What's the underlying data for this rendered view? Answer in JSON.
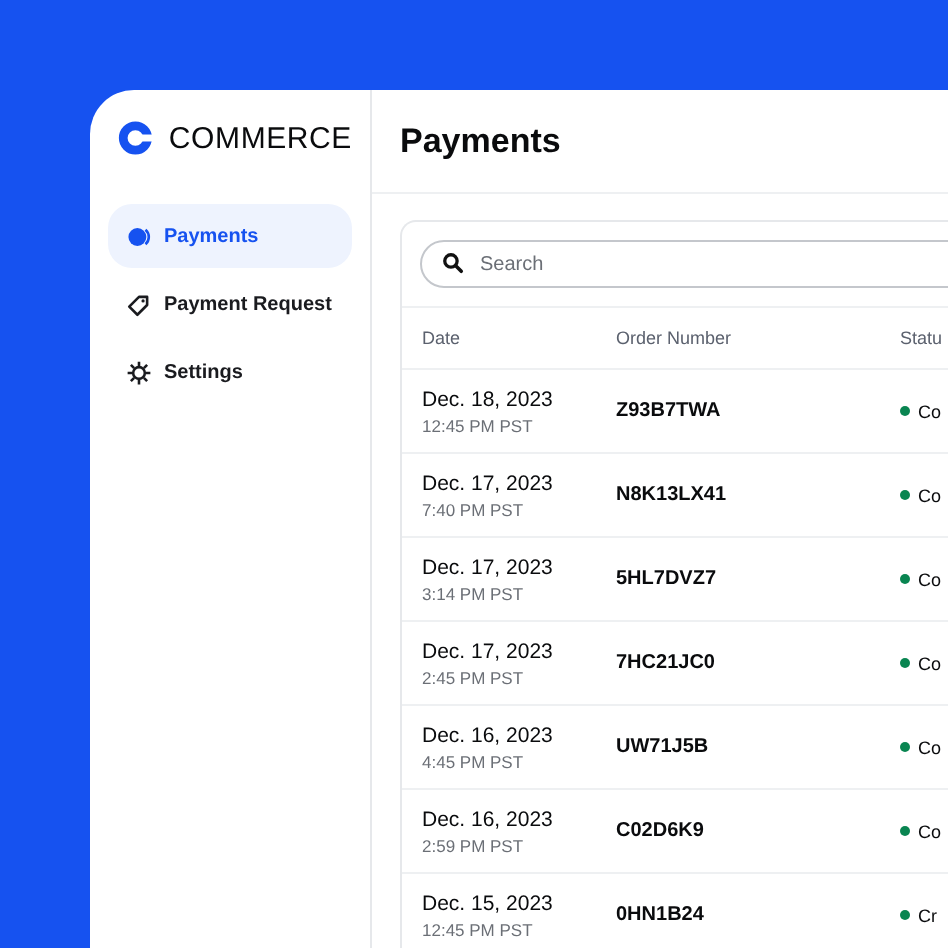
{
  "brand": {
    "name": "COMMERCE"
  },
  "sidebar": {
    "items": [
      {
        "label": "Payments",
        "selected": true,
        "kind": "payments"
      },
      {
        "label": "Payment Request",
        "selected": false,
        "kind": "tag"
      },
      {
        "label": "Settings",
        "selected": false,
        "kind": "settings"
      }
    ]
  },
  "page": {
    "title": "Payments"
  },
  "search": {
    "placeholder": "Search"
  },
  "table": {
    "columns": [
      "Date",
      "Order Number",
      "Statu"
    ],
    "rows": [
      {
        "date": "Dec. 18, 2023",
        "time": "12:45 PM PST",
        "order": "Z93B7TWA",
        "status": "Co"
      },
      {
        "date": "Dec. 17, 2023",
        "time": "7:40 PM PST",
        "order": "N8K13LX41",
        "status": "Co"
      },
      {
        "date": "Dec. 17, 2023",
        "time": "3:14 PM PST",
        "order": "5HL7DVZ7",
        "status": "Co"
      },
      {
        "date": "Dec. 17, 2023",
        "time": "2:45 PM PST",
        "order": "7HC21JC0",
        "status": "Co"
      },
      {
        "date": "Dec. 16, 2023",
        "time": "4:45 PM PST",
        "order": "UW71J5B",
        "status": "Co"
      },
      {
        "date": "Dec. 16, 2023",
        "time": "2:59 PM PST",
        "order": "C02D6K9",
        "status": "Co"
      },
      {
        "date": "Dec. 15, 2023",
        "time": "12:45 PM PST",
        "order": "0HN1B24",
        "status": "Cr"
      }
    ]
  }
}
